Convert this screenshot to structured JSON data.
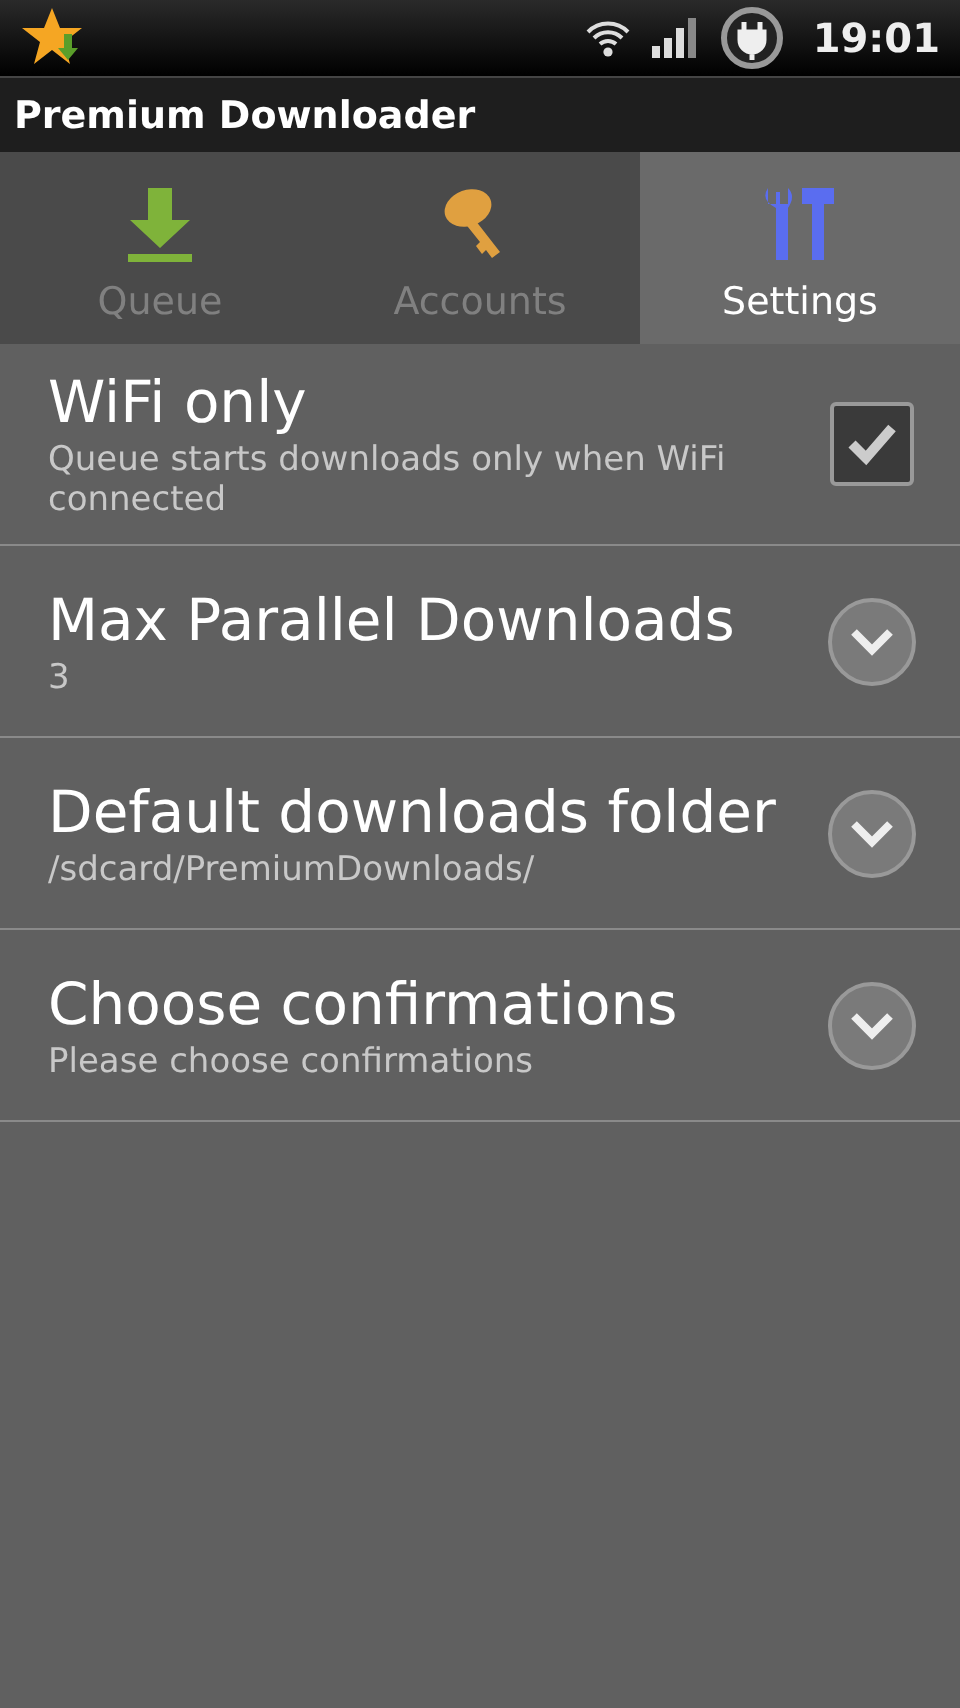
{
  "status_bar": {
    "time": "19:01"
  },
  "window": {
    "title": "Premium Downloader"
  },
  "tabs": [
    {
      "label": "Queue",
      "selected": false
    },
    {
      "label": "Accounts",
      "selected": false
    },
    {
      "label": "Settings",
      "selected": true
    }
  ],
  "settings": [
    {
      "kind": "checkbox",
      "title": "WiFi only",
      "summary": "Queue starts downloads only when WiFi connected",
      "checked": true
    },
    {
      "kind": "dropdown",
      "title": "Max Parallel Downloads",
      "summary": "3"
    },
    {
      "kind": "dropdown",
      "title": "Default downloads folder",
      "summary": "/sdcard/PremiumDownloads/"
    },
    {
      "kind": "dropdown",
      "title": "Choose confirmations",
      "summary": "Please choose confirmations"
    }
  ]
}
